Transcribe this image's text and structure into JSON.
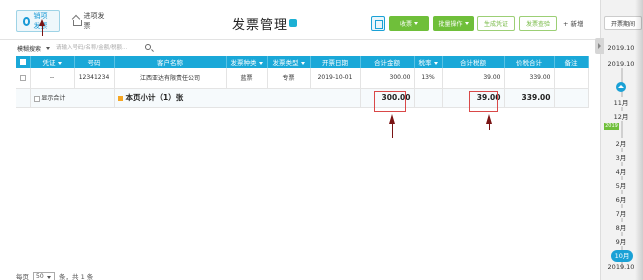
{
  "tabs": [
    {
      "label": "销项发票",
      "active": true
    },
    {
      "label": "进项发票",
      "active": false
    }
  ],
  "page_title": "发票管理",
  "toolbar": {
    "record_label": "收票",
    "batch_label": "批量操作",
    "generate_voucher_label": "生成凭证",
    "invoice_check_label": "发票查验",
    "new_label": "+ 新增"
  },
  "search": {
    "label": "模糊搜索",
    "placeholder": "请输入号码/名称/金额/税额..."
  },
  "table": {
    "headers": {
      "voucher": "凭证",
      "number": "号码",
      "customer": "客户名称",
      "invoice_kind": "发票种类",
      "invoice_type": "发票类型",
      "date": "开票日期",
      "amount": "合计金额",
      "tax_rate": "税率",
      "tax": "合计税额",
      "total": "价税合计",
      "note": "备注"
    },
    "rows": [
      {
        "voucher": "--",
        "number": "12341234",
        "customer": "江西亚达有限责任公司",
        "invoice_kind": "蓝票",
        "invoice_type": "专票",
        "date": "2019-10-01",
        "amount": "300.00",
        "tax_rate": "13%",
        "tax": "39.00",
        "total": "339.00",
        "note": ""
      }
    ],
    "summary": {
      "show_total_label": "显示合计",
      "subtotal_label": "本页小计（1）张",
      "amount": "300.00",
      "tax": "39.00",
      "total": "339.00"
    }
  },
  "pagination": {
    "prefix": "每页",
    "page_size": "50",
    "suffix": "条，共 1 条"
  },
  "period_panel": {
    "open_label": "开票期间",
    "years": [
      "2019.10",
      "2019.10"
    ],
    "year_tag": "2019",
    "months_before": [
      "11月",
      "12月"
    ],
    "months_after": [
      "2月",
      "3月",
      "4月",
      "5月",
      "6月",
      "7月",
      "8月",
      "9月"
    ],
    "current_month": "10月",
    "bottom_label": "2019.10"
  },
  "colors": {
    "accent": "#1aa8d8",
    "green": "#6fbf3a",
    "annotation_red": "#d94848",
    "arrow": "#7a1414"
  }
}
